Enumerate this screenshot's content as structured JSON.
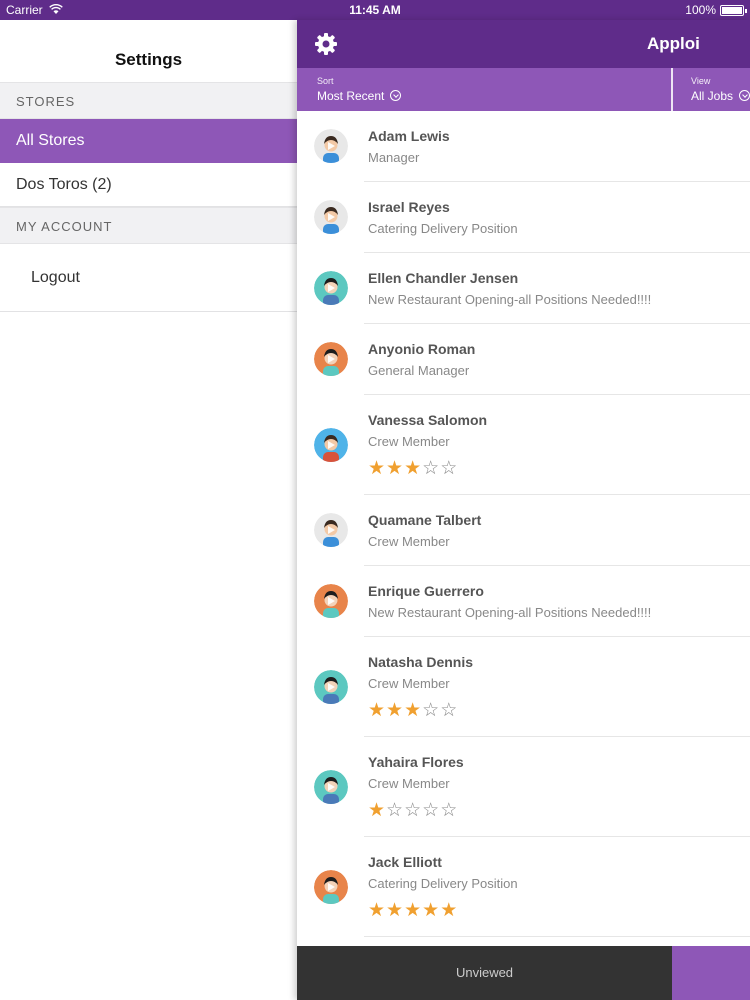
{
  "status_bar": {
    "carrier": "Carrier",
    "time": "11:45 AM",
    "battery": "100%"
  },
  "settings": {
    "title": "Settings",
    "stores_header": "STORES",
    "stores": [
      {
        "label": "All Stores",
        "selected": true
      },
      {
        "label": "Dos Toros (2)",
        "selected": false
      }
    ],
    "account_header": "MY ACCOUNT",
    "logout_label": "Logout"
  },
  "navbar": {
    "title": "Apploi",
    "settings_icon": "gear-icon"
  },
  "filters": {
    "sort_label": "Sort",
    "sort_value": "Most Recent",
    "view_label": "View",
    "view_value": "All Jobs"
  },
  "colors": {
    "brand_dark": "#5f2c8a",
    "brand": "#8e57b7",
    "star": "#f0a030"
  },
  "applicants": [
    {
      "name": "Adam Lewis",
      "job": "Manager",
      "rating": null,
      "avatar": "male-light"
    },
    {
      "name": "Israel Reyes",
      "job": "Catering Delivery Position",
      "rating": null,
      "avatar": "male-light"
    },
    {
      "name": "Ellen Chandler Jensen",
      "job": "New Restaurant Opening-all Positions Needed!!!!",
      "rating": null,
      "avatar": "female-teal"
    },
    {
      "name": "Anyonio Roman",
      "job": "General Manager",
      "rating": null,
      "avatar": "female-orange"
    },
    {
      "name": "Vanessa Salomon",
      "job": "Crew Member",
      "rating": 3,
      "avatar": "male-blue"
    },
    {
      "name": "Quamane Talbert",
      "job": "Crew Member",
      "rating": null,
      "avatar": "male-light"
    },
    {
      "name": "Enrique Guerrero",
      "job": "New Restaurant Opening-all Positions Needed!!!!",
      "rating": null,
      "avatar": "female-orange"
    },
    {
      "name": "Natasha Dennis",
      "job": "Crew Member",
      "rating": 3,
      "avatar": "female-teal"
    },
    {
      "name": "Yahaira Flores",
      "job": "Crew Member",
      "rating": 1,
      "avatar": "female-teal"
    },
    {
      "name": "Jack Elliott",
      "job": "Catering Delivery Position",
      "rating": 5,
      "avatar": "female-orange"
    }
  ],
  "bottom_tabs": {
    "unviewed_label": "Unviewed"
  }
}
